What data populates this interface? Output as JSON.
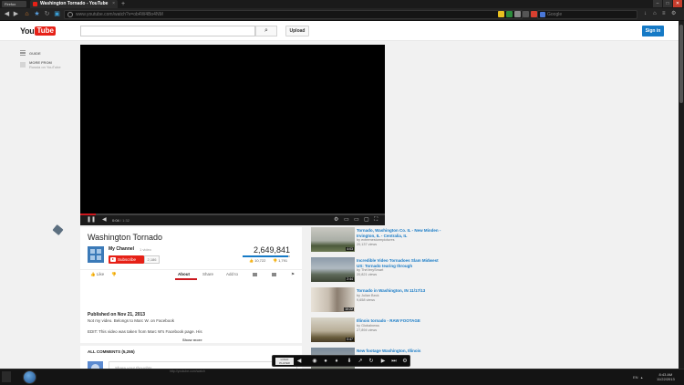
{
  "browser": {
    "menu_label": "Firefox",
    "tab_title": "Washington Tornado - YouTube",
    "tab_close": "×",
    "new_tab": "+",
    "url": "www.youtube.com/watch?v=ob4W4Bo4NM",
    "search_placeholder": "Google",
    "window_buttons": {
      "minimize": "–",
      "maximize": "□",
      "close": "✕"
    }
  },
  "yt_header": {
    "logo_you": "You",
    "logo_tube": "Tube",
    "search_placeholder": "",
    "search_icon": "⌕",
    "upload_label": "Upload",
    "signin_label": "Sign in"
  },
  "guide": {
    "guide_label": "GUIDE",
    "more_from_label": "MORE FROM",
    "more_from_sub": "Russia on YouTube"
  },
  "player": {
    "current_time": "0:04",
    "duration": "/ 1:32",
    "progress": 0.05
  },
  "video": {
    "title": "Washington Tornado",
    "channel": "My Channel",
    "video_count": "1 video",
    "subscribe_label": "Subscribe",
    "subscriber_count": "2,186",
    "views": "2,649,841",
    "likes": "10,722",
    "dislikes": "1,791",
    "like_label": "Like",
    "tabs": [
      "About",
      "Share",
      "Add to"
    ],
    "published": "Published on Nov 21, 2013",
    "description_line1": "Not my video. Belongs to Marc W. on Facebook",
    "description_line2": "EDIT: This video was taken from Marc W's Facebook page. His",
    "show_more": "Show more"
  },
  "comments": {
    "header": "ALL COMMENTS (5,255)",
    "placeholder": "Share your thoughts"
  },
  "related": [
    {
      "title": "Tornado, Washington Co. IL - New Minden - Irvington, IL - Centralia, IL",
      "by": "by extremestormpictures",
      "views": "20,137 views",
      "duration": "4:03"
    },
    {
      "title": "Incredible Video Tornadoes Slam Midwest US: Tornado tearing through",
      "by": "by TheVerySmart",
      "views": "20,821 views",
      "duration": "2:44"
    },
    {
      "title": "Tornado in Washington, IN 11/17/13",
      "by": "by Julian Beck",
      "views": "9,658 views",
      "duration": "10:22"
    },
    {
      "title": "Illinois tornado - RAW FOOTAGE",
      "by": "by Globalnews",
      "views": "27,894 views",
      "duration": "0:47"
    },
    {
      "title": "New footage Washington, Illinois",
      "by": "",
      "views": "",
      "duration": ""
    }
  ],
  "mini_player": {
    "logo_text": "LOGO PLAYER"
  },
  "taskbar": {
    "status_text": "http://youtube.com/watch",
    "lang": "EN",
    "time": "8:43 AM",
    "date": "11/22/2013"
  }
}
